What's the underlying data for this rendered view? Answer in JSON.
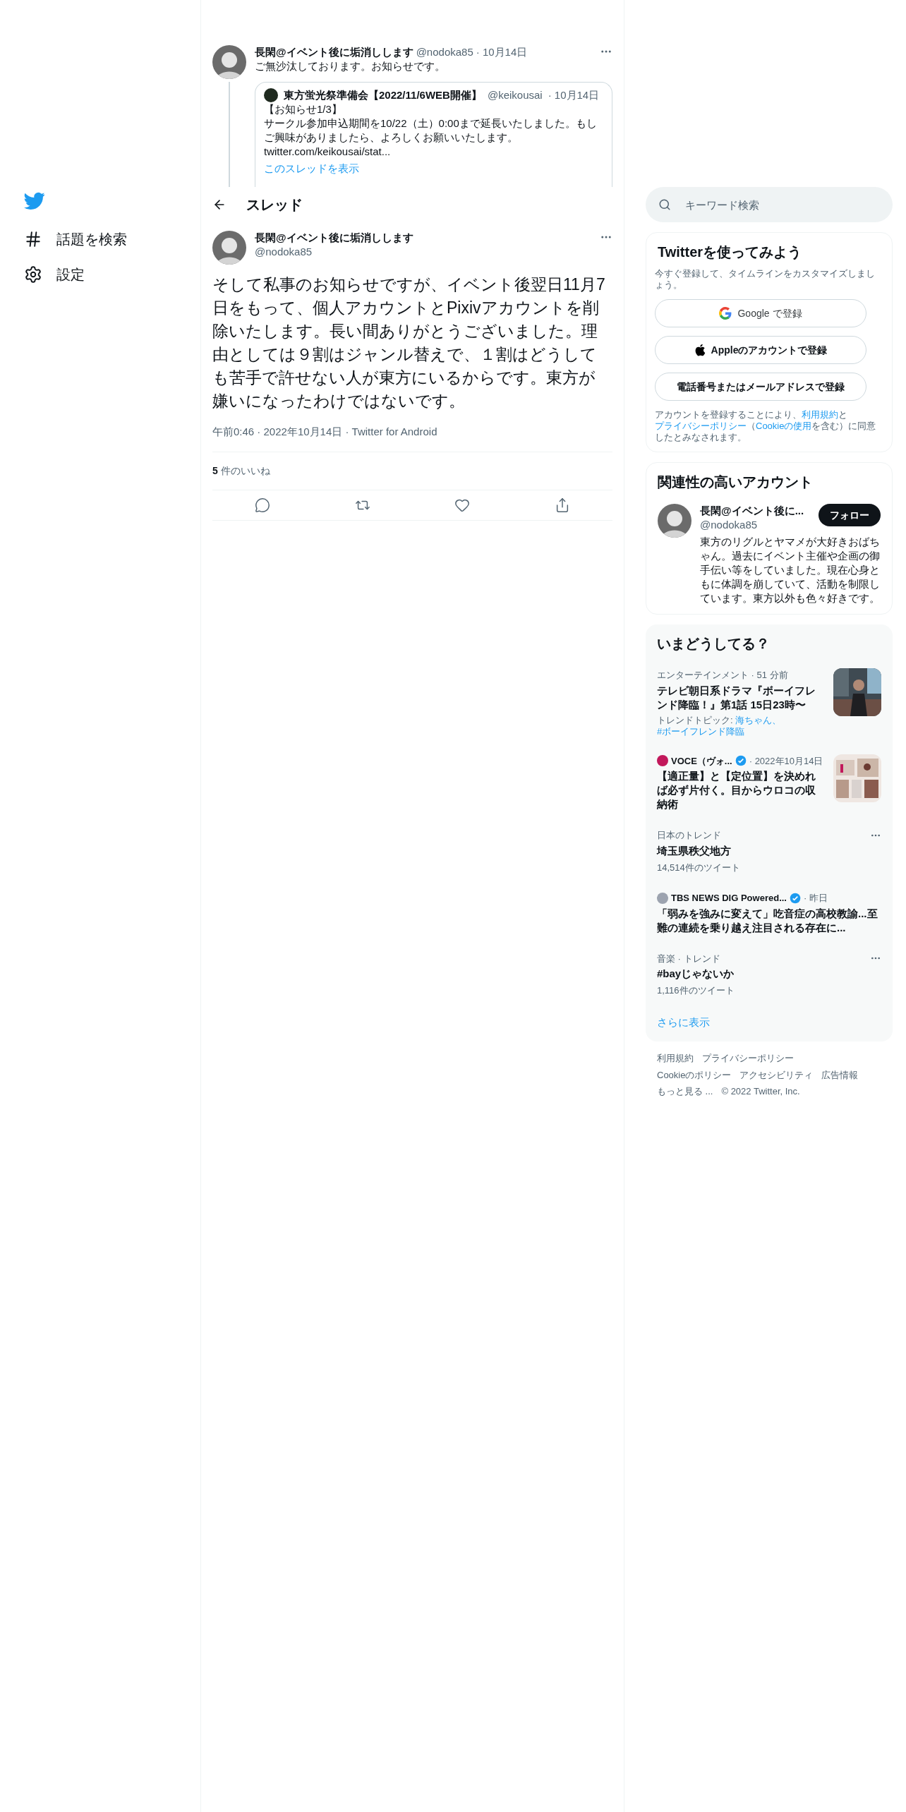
{
  "sidebar": {
    "items": [
      {
        "label": "話題を検索",
        "kind": "hashtag"
      },
      {
        "label": "設定",
        "kind": "settings"
      }
    ]
  },
  "thread": {
    "parent_tweet": {
      "name": "長閑@イベント後に垢消しします",
      "handle": "@nodoka85",
      "date": "· 10月14日",
      "text": "ご無沙汰しております。お知らせです。",
      "quote": {
        "name": "東方蛍光祭準備会【2022/11/6WEB開催】",
        "handle": "@keikousai",
        "date": "· 10月14日",
        "lines": [
          "【お知らせ1/3】",
          "サークル参加申込期間を10/22（土）0:00まで延長いたしました。もしご興味がありましたら、よろしくお願いいたします。",
          "twitter.com/keikousai/stat..."
        ],
        "show_thread": "このスレッドを表示"
      }
    },
    "header": {
      "title": "スレッド"
    },
    "main_tweet": {
      "name": "長閑@イベント後に垢消しします",
      "handle": "@nodoka85",
      "text": "そして私事のお知らせですが、イベント後翌日11月7日をもって、個人アカウントとPixivアカウントを削除いたします。長い間ありがとうございました。理由としては９割はジャンル替えで、１割はどうしても苦手で許せない人が東方にいるからです。東方が嫌いになったわけではないです。",
      "meta": "午前0:46 · 2022年10月14日 · Twitter for Android",
      "likes_count": "5",
      "likes_label": "件のいいね",
      "actions": [
        {
          "kind": "reply"
        },
        {
          "kind": "retweet"
        },
        {
          "kind": "like"
        },
        {
          "kind": "share"
        }
      ]
    }
  },
  "search": {
    "placeholder": "キーワード検索"
  },
  "signup": {
    "title": "Twitterを使ってみよう",
    "subtitle": "今すぐ登録して、タイムラインをカスタマイズしましょう。",
    "buttons": [
      {
        "label": "Google で登録",
        "kind": "google"
      },
      {
        "label": "Appleのアカウントで登録",
        "kind": "apple"
      },
      {
        "label": "電話番号またはメールアドレスで登録",
        "kind": "plain"
      }
    ],
    "terms": [
      {
        "text": "アカウントを登録することにより、",
        "link": false
      },
      {
        "text": "利用規約",
        "link": true
      },
      {
        "text": "と",
        "link": false
      },
      {
        "text": "プライバシーポリシー",
        "link": true
      },
      {
        "text": "（",
        "link": false
      },
      {
        "text": "Cookieの使用",
        "link": true
      },
      {
        "text": "を含む）に同意したとみなされます。",
        "link": false
      }
    ]
  },
  "related": {
    "title": "関連性の高いアカウント",
    "account": {
      "name": "長閑@イベント後に...",
      "handle": "@nodoka85",
      "bio": "東方のリグルとヤマメが大好きおばちゃん。過去にイベント主催や企画の御手伝い等をしていました。現在心身ともに体調を崩していて、活動を制限しています。東方以外も色々好きです。",
      "follow": "フォロー"
    }
  },
  "trends": {
    "title": "いまどうしてる？",
    "items": [
      {
        "context": "エンターテインメント · 51 分前",
        "title": "テレビ朝日系ドラマ『ボーイフレンド降臨！』第1話 15日23時〜",
        "topic_prefix": "トレンドトピック: ",
        "topic_links": [
          "海ちゃん、",
          "#ボーイフレンド降臨"
        ],
        "thumbnail": {
          "kind": "picture"
        }
      },
      {
        "source": {
          "name": "VOCE（ヴォ...",
          "verified": true,
          "color": "#c2185b"
        },
        "context": "· 2022年10月14日",
        "title": "【適正量】と【定位置】を決めれば必ず片付く。目からウロコの収納術",
        "thumbnail": {
          "kind": "picture"
        }
      },
      {
        "context": "日本のトレンド",
        "title": "埼玉県秩父地方",
        "count": "14,514件のツイート",
        "more": true
      },
      {
        "source": {
          "name": "TBS NEWS DIG Powered...",
          "verified": true,
          "color": "#9ca3af"
        },
        "context": "· 昨日",
        "title": "「弱みを強みに変えて」吃音症の高校教諭...至難の連続を乗り越え注目される存在に..."
      },
      {
        "context": "音楽 · トレンド",
        "title": "#bayじゃないか",
        "count": "1,116件のツイート",
        "more": true
      }
    ],
    "show_more": "さらに表示"
  },
  "footer": {
    "rows": [
      [
        "利用規約",
        "プライバシーポリシー"
      ],
      [
        "Cookieのポリシー",
        "アクセシビリティ",
        "広告情報"
      ],
      [
        "もっと見る ...",
        "© 2022 Twitter, Inc."
      ]
    ]
  }
}
